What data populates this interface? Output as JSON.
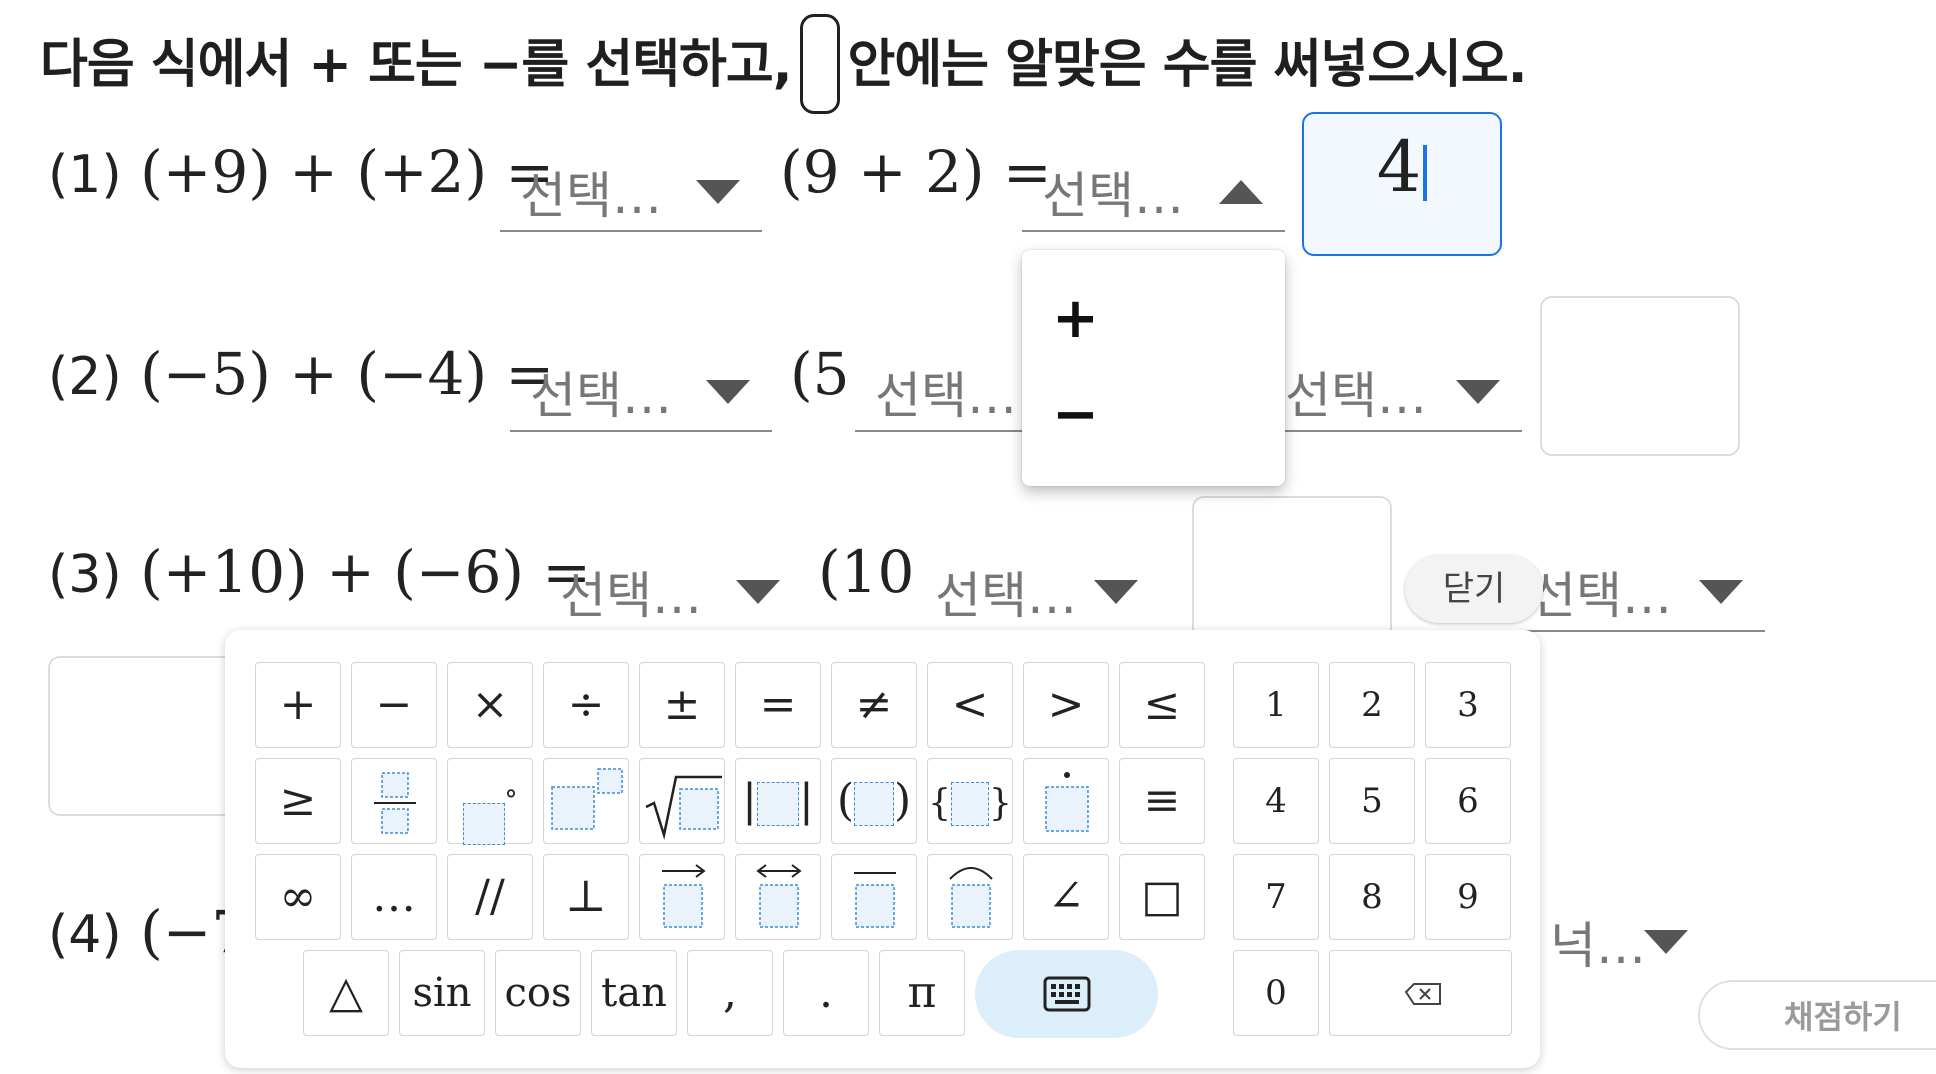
{
  "instruction": {
    "part1": "다음 식에서 + 또는 −를 선택하고,",
    "part2": "안에는 알맞은 수를 써넣으시오."
  },
  "problems": {
    "p1": {
      "num": "(1)",
      "left_expr": "(+9) + (+2) =",
      "mid_expr": "(9 + 2) =",
      "answer": "4"
    },
    "p2": {
      "num": "(2)",
      "left_expr": "(−5) + (−4) =",
      "mid_expr": "(5"
    },
    "p3": {
      "num": "(3)",
      "left_expr": "(+10) + (−6) =",
      "mid_expr": "(10"
    },
    "p4": {
      "num": "(4)",
      "left_expr": "(−7"
    }
  },
  "select_placeholder": "선택…",
  "select_placeholder_clipped": "넉…",
  "dropdown": {
    "options": [
      "+",
      "−"
    ]
  },
  "close_label": "닫기",
  "grade_label": "채점하기",
  "keypad": {
    "row1": [
      "+",
      "−",
      "×",
      "÷",
      "±",
      "=",
      "≠",
      "<",
      ">",
      "≤"
    ],
    "row2_symbols": {
      "geq": "≥",
      "degree": "°",
      "equiv": "≡",
      "abs_l": "|",
      "abs_r": "|",
      "paren_l": "(",
      "paren_r": ")",
      "brace_l": "{",
      "brace_r": "}",
      "dot": "·",
      "sqrt": "√"
    },
    "row3": {
      "infinity": "∞",
      "ellipsis": "…",
      "parallel": "//",
      "perp": "⊥",
      "vec_arrow": "→",
      "line_arrow": "↔",
      "overline": "‾",
      "arc": "⌒",
      "angle": "∠",
      "square": "□"
    },
    "row4": [
      "△",
      "sin",
      "cos",
      "tan",
      ",",
      ".",
      "π"
    ],
    "digits": [
      "1",
      "2",
      "3",
      "4",
      "5",
      "6",
      "7",
      "8",
      "9",
      "0"
    ]
  },
  "icons": {
    "keyboard": "keyboard-icon",
    "backspace": "backspace-icon"
  },
  "colors": {
    "accent": "#1a73e8",
    "placeholder_border": "#3a8de0",
    "keyboard_btn_bg": "#ddeefb"
  }
}
